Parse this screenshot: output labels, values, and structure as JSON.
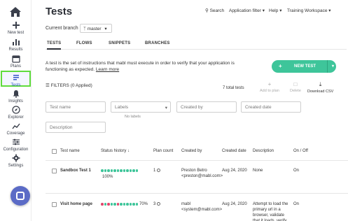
{
  "sidebar": {
    "items": [
      {
        "label": "New test",
        "icon": "plus-icon"
      },
      {
        "label": "Results",
        "icon": "bar-chart-icon"
      },
      {
        "label": "Plans",
        "icon": "calendar-icon"
      },
      {
        "label": "Tests",
        "icon": "list-icon"
      },
      {
        "label": "Insights",
        "icon": "bell-icon"
      },
      {
        "label": "Explorer",
        "icon": "compass-icon"
      },
      {
        "label": "Coverage",
        "icon": "trend-icon"
      },
      {
        "label": "Configuration",
        "icon": "sliders-icon"
      },
      {
        "label": "Settings",
        "icon": "gear-icon"
      }
    ]
  },
  "header": {
    "title": "Tests",
    "search": "Search",
    "app_filter": "Application filter",
    "help": "Help",
    "workspace": "Training Workspace"
  },
  "branch": {
    "label": "Current branch",
    "value": "master"
  },
  "tabs": [
    "TESTS",
    "FLOWS",
    "SNIPPETS",
    "BRANCHES"
  ],
  "description": {
    "text": "A test is the set of instructions that mabl must execute in order to verify that your application is functioning as expected.",
    "link": "Learn more"
  },
  "new_test_button": "NEW TEST",
  "filters": {
    "label": "FILTERS (0 Applied)",
    "total": "7 total tests"
  },
  "actions": {
    "add_to_plan": "Add to plan",
    "delete": "Delete",
    "download": "Download CSV"
  },
  "inputs": {
    "test_name": "Test name",
    "labels": "Labels",
    "no_labels": "No labels",
    "created_by": "Created by",
    "created_date": "Created date",
    "description": "Description"
  },
  "table": {
    "headers": [
      "Test name",
      "Status history",
      "Plan count",
      "Created by",
      "Created date",
      "Description",
      "On / Off"
    ],
    "rows": [
      {
        "name": "Sandbox Test 1",
        "status_pct": "100%",
        "plan_count": "1",
        "created_by": "Preston Betro <preston@mabl.com>",
        "created_date": "Aug 24, 2020",
        "description": "None",
        "onoff": "On",
        "dots": [
          "#3ec59a",
          "#3ec59a",
          "#3ec59a",
          "#3ec59a",
          "#3ec59a",
          "#3ec59a",
          "#3ec59a",
          "#3ec59a",
          "#3ec59a",
          "#3ec59a",
          "#3ec59a",
          "#3ec59a"
        ]
      },
      {
        "name": "Visit home page",
        "status_pct": "70%",
        "plan_count": "3",
        "created_by": "mabl <system@mabl.com>",
        "created_date": "Aug 24, 2020",
        "description": "Attempt to load the primary url in a browser, validate that it loads, verify",
        "onoff": "On",
        "dots": [
          "#e0466b",
          "#3ec59a",
          "#e0466b",
          "#3ec59a",
          "#3ec59a",
          "#e0466b",
          "#3ec59a",
          "#3ec59a",
          "#3ec59a",
          "#3ec59a",
          "#3ec59a",
          "#3ec59a"
        ]
      }
    ]
  },
  "colors": {
    "accent": "#3ec59a",
    "fail": "#e0466b",
    "highlight": "#5fdc3c",
    "help": "#5b6bc6"
  }
}
